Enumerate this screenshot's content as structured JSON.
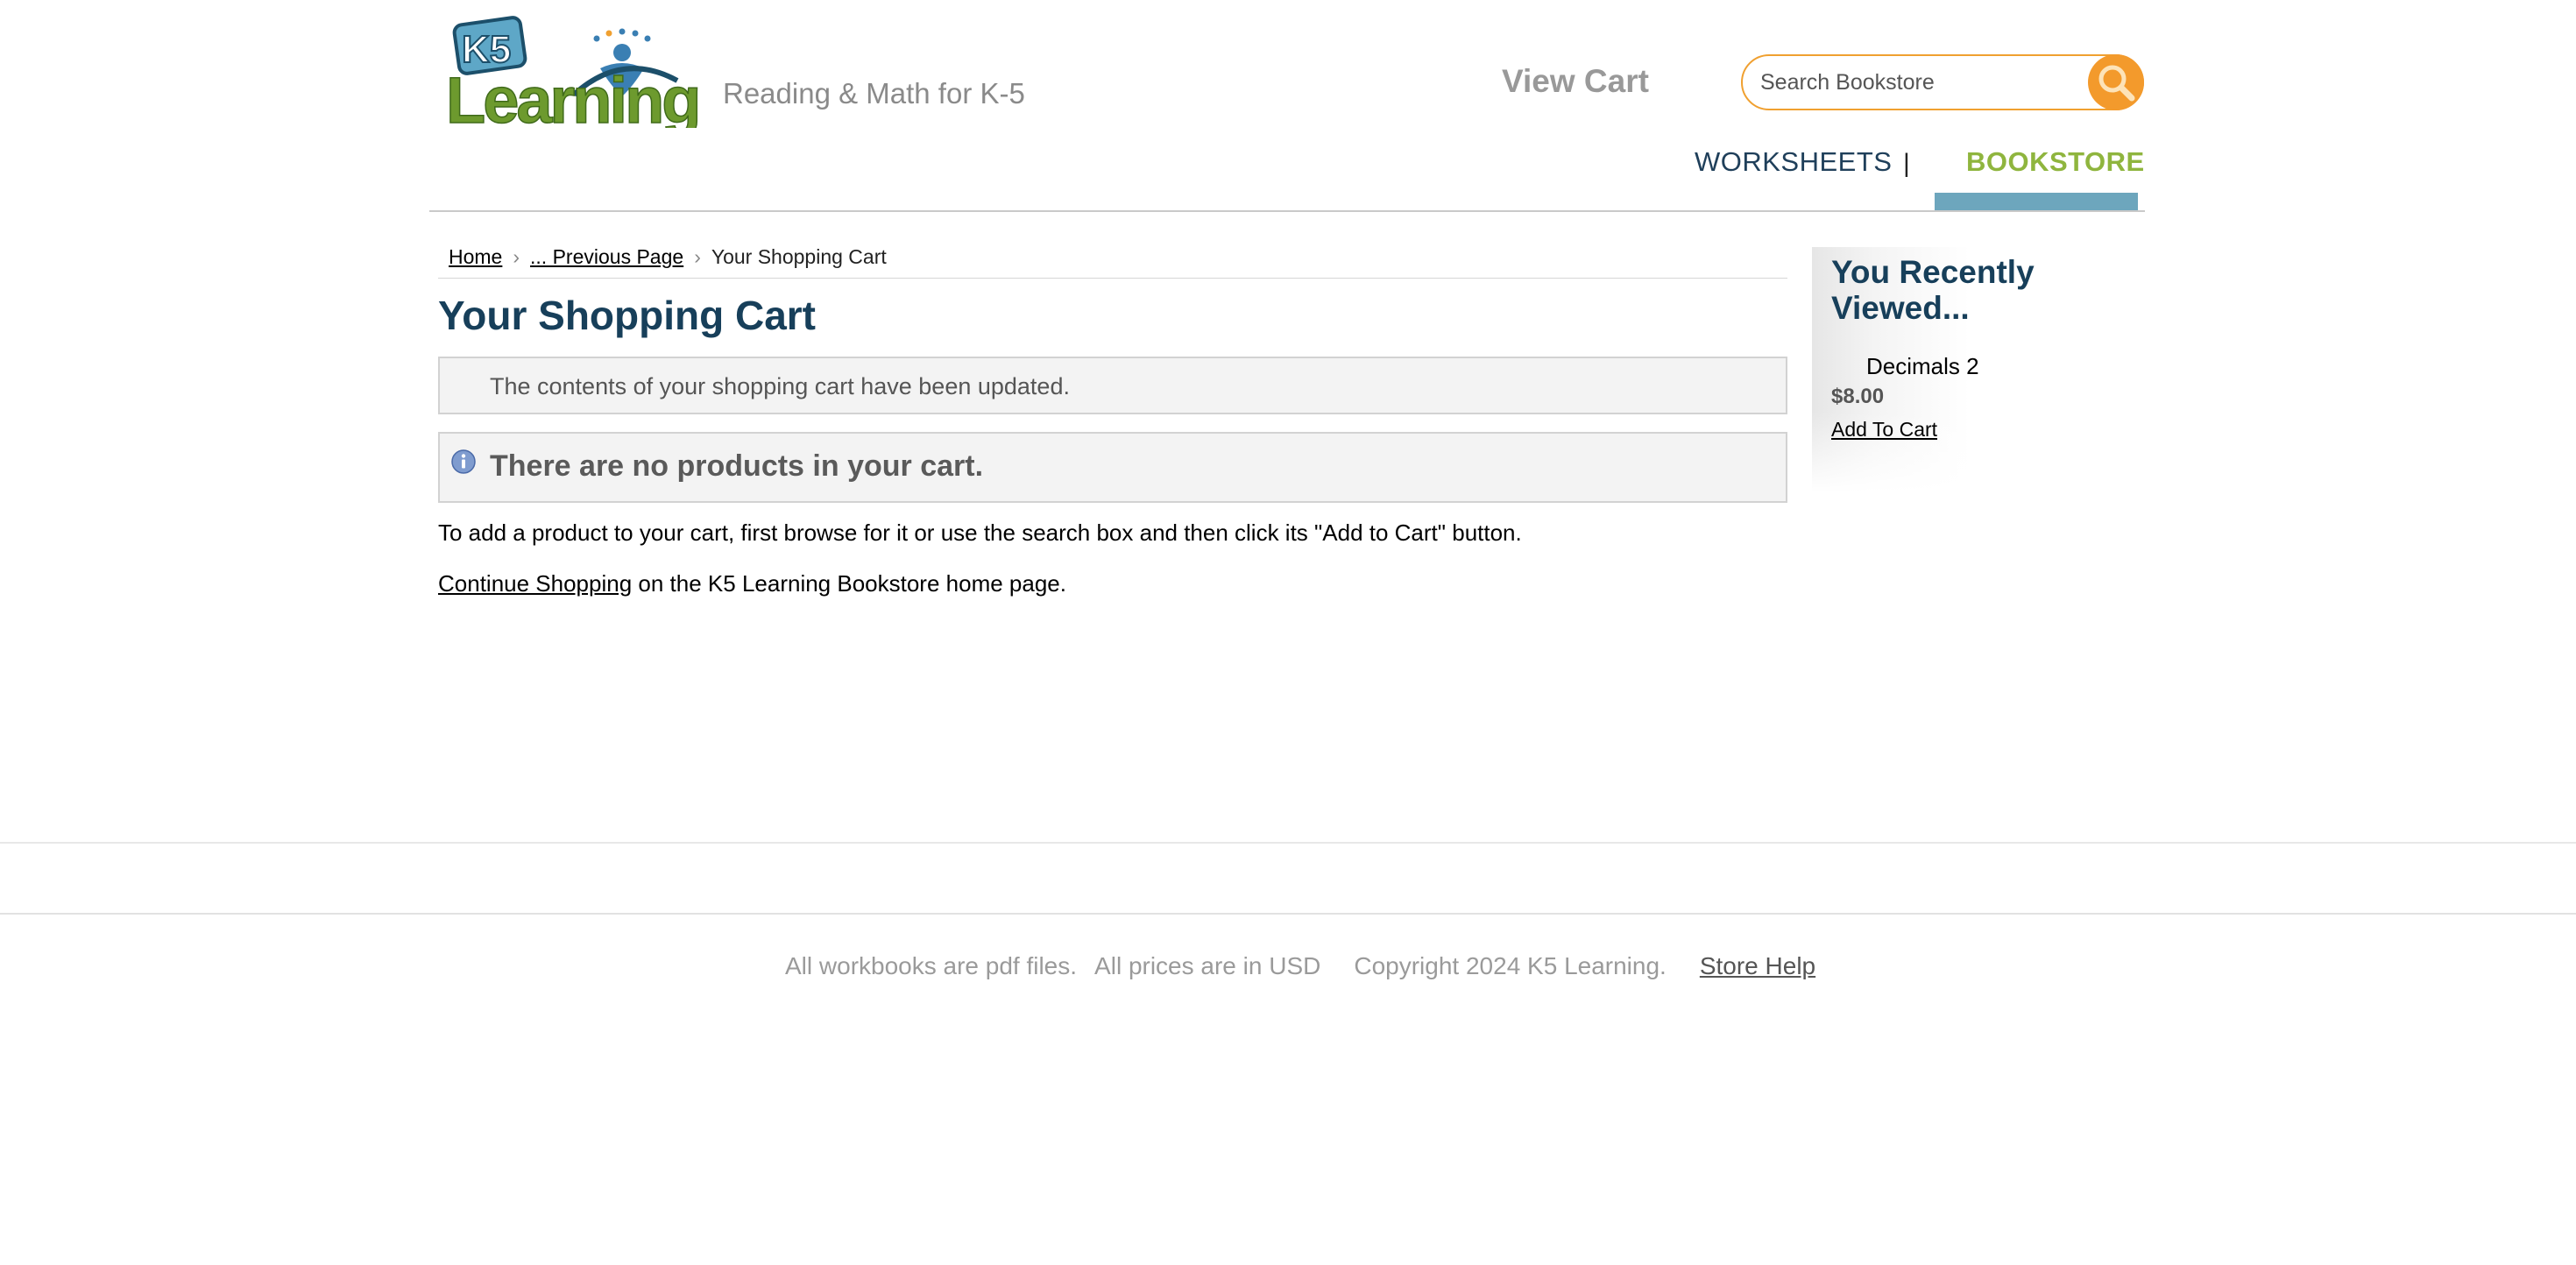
{
  "header": {
    "logo": {
      "line1": "K5",
      "line2": "Learning"
    },
    "tagline": "Reading & Math for K-5",
    "view_cart": "View Cart",
    "search": {
      "placeholder": "Search Bookstore",
      "value": ""
    },
    "nav": {
      "worksheets": "WORKSHEETS",
      "separator": "|",
      "bookstore": "BOOKSTORE",
      "active": "bookstore"
    }
  },
  "breadcrumb": {
    "home": "Home",
    "previous": "... Previous Page",
    "current": "Your Shopping Cart"
  },
  "main": {
    "title": "Your Shopping Cart",
    "notice": "The contents of your shopping cart have been updated.",
    "empty_message": "There are no products in your cart.",
    "instructions": "To add a product to your cart, first browse for it or use the search box and then click its \"Add to Cart\" button.",
    "continue_link": "Continue Shopping",
    "continue_suffix": " on the K5 Learning Bookstore home page."
  },
  "sidebar": {
    "title": "You Recently Viewed...",
    "items": [
      {
        "name": "Decimals 2",
        "price": "$8.00",
        "action": "Add To Cart"
      }
    ]
  },
  "footer": {
    "pdf_note": "All workbooks are pdf files.",
    "currency_note": "All prices are in USD",
    "copyright": "Copyright 2024 K5 Learning.",
    "help_link": "Store Help"
  },
  "colors": {
    "title_navy": "#173f5a",
    "brand_green": "#8fb53e",
    "search_orange": "#f39a2c",
    "nav_active_bar": "#6da6bd",
    "footer_gray": "#9a9a9a"
  },
  "icons": {
    "search": "magnifier-icon",
    "info": "info-icon",
    "logo": "k5-learning-logo"
  }
}
